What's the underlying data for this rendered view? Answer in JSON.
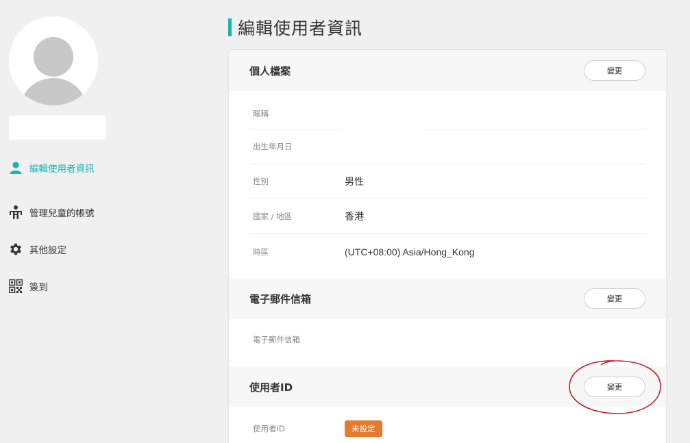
{
  "page": {
    "title": "編輯使用者資訊"
  },
  "sidebar": {
    "items": [
      {
        "label": "編輯使用者資訊",
        "icon": "user-icon",
        "active": true
      },
      {
        "label": "管理兒童的帳號",
        "icon": "child-account-icon",
        "active": false
      },
      {
        "label": "其他設定",
        "icon": "gear-icon",
        "active": false
      },
      {
        "label": "簽到",
        "icon": "qr-code-icon",
        "active": false
      }
    ]
  },
  "profile": {
    "heading": "個人檔案",
    "change_label": "變更",
    "fields": {
      "nickname": {
        "label": "暱稱",
        "value": ""
      },
      "birthday": {
        "label": "出生年月日",
        "value": ""
      },
      "gender": {
        "label": "性別",
        "value": "男性"
      },
      "region": {
        "label": "國家 / 地區",
        "value": "香港"
      },
      "timezone": {
        "label": "時區",
        "value": "(UTC+08:00) Asia/Hong_Kong"
      }
    }
  },
  "email": {
    "heading": "電子郵件信箱",
    "change_label": "變更",
    "field_label": "電子郵件信箱",
    "value": ""
  },
  "userid": {
    "heading": "使用者ID",
    "change_label": "變更",
    "field_label": "使用者ID",
    "status": "未設定"
  },
  "colors": {
    "accent": "#1ab5b0",
    "badge": "#e37a2d",
    "annotation": "#c0202a"
  }
}
